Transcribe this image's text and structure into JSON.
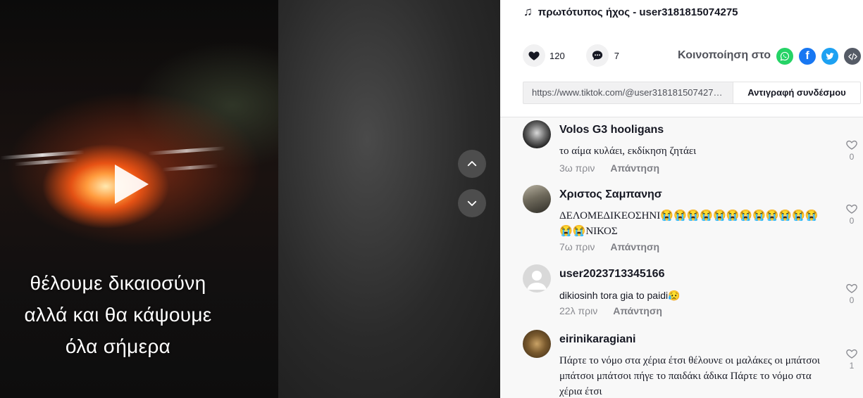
{
  "video": {
    "caption_lines": [
      "θέλουμε δικαιοσύνη",
      "αλλά και θα κάψουμε",
      "όλα σήμερα"
    ],
    "play_icon": "play-icon",
    "nav_up_icon": "chevron-up-icon",
    "nav_down_icon": "chevron-down-icon"
  },
  "sound": {
    "icon": "music-note-icon",
    "note_glyph": "♫",
    "label": "πρωτότυπος ήχος - user3181815074275"
  },
  "stats": {
    "likes": "120",
    "comments": "7"
  },
  "share": {
    "label": "Κοινοποίηση στο",
    "icons": [
      "whatsapp-icon",
      "facebook-icon",
      "twitter-icon",
      "embed-icon"
    ]
  },
  "link": {
    "url": "https://www.tiktok.com/@user3181815074275...",
    "copy_label": "Αντιγραφή συνδέσμου"
  },
  "comments": [
    {
      "user": "Volos G3 hooligans",
      "text": "το αίμα κυλάει, εκδίκηση ζητάει",
      "time": "3ω πριν",
      "reply": "Απάντηση",
      "likes": "0"
    },
    {
      "user": "Χριστος Σαμπανησ",
      "text": "ΔΕΛΟΜΕΔΙΚΕΟΣΗΝΙ😭😭😭😭😭😭😭😭😭😭😭😭😭😭ΝΙΚΟΣ",
      "time": "7ω πριν",
      "reply": "Απάντηση",
      "likes": "0"
    },
    {
      "user": "user2023713345166",
      "text": "dikiosinh tora gia to paidi😥",
      "time": "22λ πριν",
      "reply": "Απάντηση",
      "likes": "0"
    },
    {
      "user": "eirinikaragiani",
      "text": "Πάρτε το νόμο στα χέρια έτσι θέλουνε οι μαλάκες οι μπάτσοι μπάτσοι μπάτσοι πήγε το παιδάκι άδικα Πάρτε το νόμο στα χέρια έτσι",
      "time": "",
      "reply": "",
      "likes": "1"
    }
  ],
  "colors": {
    "whatsapp": "#25d366",
    "facebook": "#1877f2",
    "twitter": "#1da1f2",
    "embed": "#555b66"
  }
}
